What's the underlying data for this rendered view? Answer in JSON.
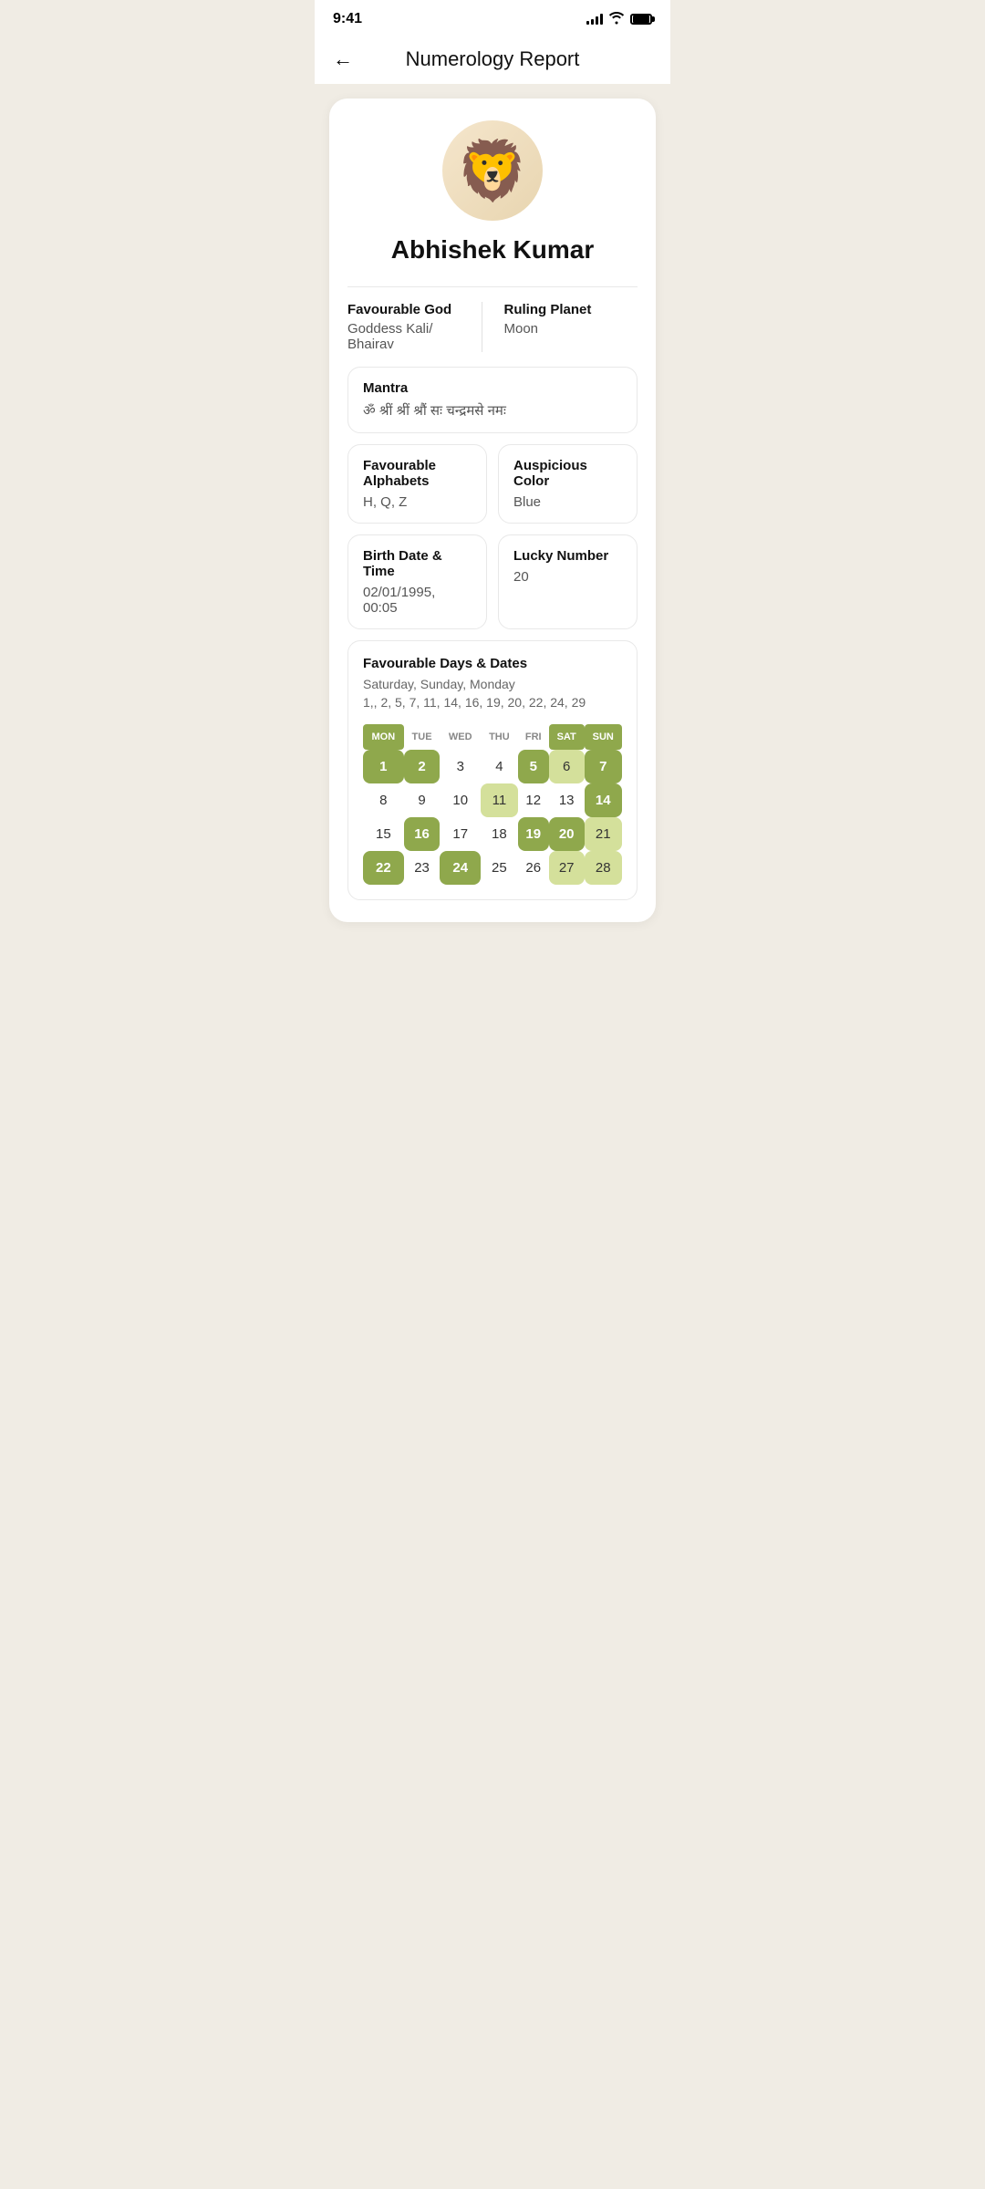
{
  "statusBar": {
    "time": "9:41",
    "battery": "full"
  },
  "header": {
    "title": "Numerology Report",
    "backLabel": "←"
  },
  "profile": {
    "name": "Abhishek Kumar",
    "avatarEmoji": "🦁"
  },
  "details": {
    "favourableGodLabel": "Favourable God",
    "favourableGodValue": "Goddess Kali/ Bhairav",
    "rulingPlanetLabel": "Ruling Planet",
    "rulingPlanetValue": "Moon",
    "mantraLabel": "Mantra",
    "mantraValue": "ॐ श्रीं श्रीं श्रौं सः चन्द्रमसे नमः",
    "favourableAlphabetsLabel": "Favourable Alphabets",
    "favourableAlphabetsValue": "H, Q, Z",
    "auspiciousColorLabel": "Auspicious Color",
    "auspiciousColorValue": "Blue",
    "birthDateLabel": "Birth Date & Time",
    "birthDateValue": "02/01/1995, 00:05",
    "luckyNumberLabel": "Lucky Number",
    "luckyNumberValue": "20"
  },
  "favourableDays": {
    "title": "Favourable Days & Dates",
    "days": "Saturday, Sunday, Monday",
    "dates": "1,, 2, 5, 7, 11, 14, 16, 19, 20, 22, 24, 29"
  },
  "calendar": {
    "headers": [
      "MON",
      "TUE",
      "WED",
      "THU",
      "FRI",
      "SAT",
      "SUN"
    ],
    "highlightedHeaders": [
      "MON",
      "SAT",
      "SUN"
    ],
    "rows": [
      [
        {
          "day": "1",
          "type": "highlighted"
        },
        {
          "day": "2",
          "type": "highlighted"
        },
        {
          "day": "3",
          "type": "normal"
        },
        {
          "day": "4",
          "type": "normal"
        },
        {
          "day": "5",
          "type": "highlighted"
        },
        {
          "day": "6",
          "type": "light"
        },
        {
          "day": "7",
          "type": "highlighted"
        }
      ],
      [
        {
          "day": "8",
          "type": "normal"
        },
        {
          "day": "9",
          "type": "normal"
        },
        {
          "day": "10",
          "type": "normal"
        },
        {
          "day": "11",
          "type": "light"
        },
        {
          "day": "12",
          "type": "normal"
        },
        {
          "day": "13",
          "type": "normal"
        },
        {
          "day": "14",
          "type": "highlighted"
        }
      ],
      [
        {
          "day": "15",
          "type": "normal"
        },
        {
          "day": "16",
          "type": "highlighted"
        },
        {
          "day": "17",
          "type": "normal"
        },
        {
          "day": "18",
          "type": "normal"
        },
        {
          "day": "19",
          "type": "highlighted"
        },
        {
          "day": "20",
          "type": "highlighted"
        },
        {
          "day": "21",
          "type": "light"
        }
      ],
      [
        {
          "day": "22",
          "type": "highlighted"
        },
        {
          "day": "23",
          "type": "normal"
        },
        {
          "day": "24",
          "type": "highlighted"
        },
        {
          "day": "25",
          "type": "normal"
        },
        {
          "day": "26",
          "type": "normal"
        },
        {
          "day": "27",
          "type": "light"
        },
        {
          "day": "28",
          "type": "light"
        }
      ]
    ]
  }
}
